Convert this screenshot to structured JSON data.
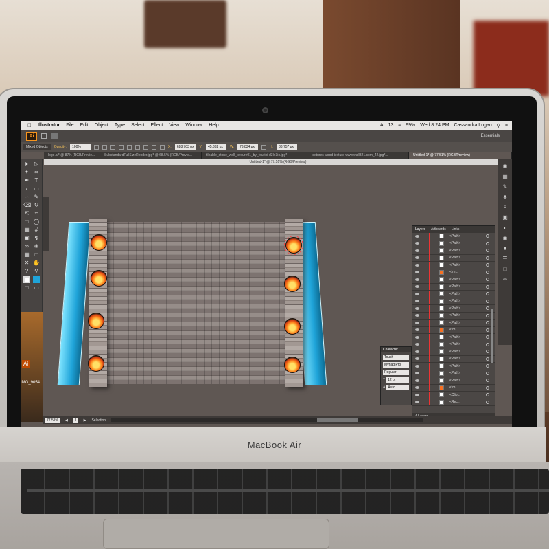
{
  "device_brand": "MacBook Air",
  "menubar": {
    "app_name": "Illustrator",
    "menus": [
      "File",
      "Edit",
      "Object",
      "Type",
      "Select",
      "Effect",
      "View",
      "Window",
      "Help"
    ],
    "adobe_badge": "13",
    "battery": "99%",
    "clock": "Wed 8:24 PM",
    "user": "Cassandra Logan"
  },
  "appbar": {
    "logo": "Ai",
    "workspace": "Essentials"
  },
  "control_bar": {
    "selection_type": "Mixed Objects",
    "opacity_label": "Opacity:",
    "opacity_value": "100%",
    "x_label": "X:",
    "x_value": "628.703 px",
    "y_label": "Y:",
    "y_value": "45.832 px",
    "w_label": "W:",
    "w_value": "73.834 px",
    "h_label": "H:",
    "h_value": "88.757 px"
  },
  "tabs": [
    "logo.ai* @ 87% (RGB/Previe...",
    "SubstandardFullSizeRender.jpg* @ 68.5% (RGB/Previe...",
    "tileable_stone_wall_texture01_by_fourini-d3le3io.jpg*",
    "textures wood texture www.wall321.com_42.jpg*...",
    "Untitled-1* @ 77.51% (RGB/Preview)"
  ],
  "document_title": "Untitled-1* @ 77.51% (RGB/Preview)",
  "status_bar": {
    "zoom": "77.51%",
    "artboard": "1",
    "tool_name": "Selection"
  },
  "layers_panel": {
    "tabs": [
      "Layers",
      "Artboards",
      "Links"
    ],
    "rows": [
      {
        "name": "<Path>",
        "type": "path"
      },
      {
        "name": "<Path>",
        "type": "path"
      },
      {
        "name": "<Path>",
        "type": "path"
      },
      {
        "name": "<Path>",
        "type": "path"
      },
      {
        "name": "<Path>",
        "type": "path"
      },
      {
        "name": "<Im...",
        "type": "image"
      },
      {
        "name": "<Path>",
        "type": "path"
      },
      {
        "name": "<Path>",
        "type": "path"
      },
      {
        "name": "<Path>",
        "type": "path"
      },
      {
        "name": "<Path>",
        "type": "path"
      },
      {
        "name": "<Path>",
        "type": "path"
      },
      {
        "name": "<Path>",
        "type": "path"
      },
      {
        "name": "<Path>",
        "type": "path"
      },
      {
        "name": "<Im...",
        "type": "image"
      },
      {
        "name": "<Path>",
        "type": "path"
      },
      {
        "name": "<Path>",
        "type": "path"
      },
      {
        "name": "<Path>",
        "type": "path"
      },
      {
        "name": "<Path>",
        "type": "path"
      },
      {
        "name": "<Path>",
        "type": "path"
      },
      {
        "name": "<Path>",
        "type": "path"
      },
      {
        "name": "<Path>",
        "type": "path"
      },
      {
        "name": "<Im...",
        "type": "image"
      },
      {
        "name": "<Clip...",
        "type": "clip"
      },
      {
        "name": "<Rec...",
        "type": "rect"
      }
    ],
    "footer": "4 Layers"
  },
  "character_panel": {
    "title": "Character",
    "touch_label": "Touch",
    "font_family": "Myriad Pro",
    "font_style": "Regular",
    "font_size": "12 pt",
    "leading": "Auto"
  },
  "dock": {
    "ai_label": "Ai",
    "image_label": "IMG_9054"
  },
  "colors": {
    "ai_orange": "#f7941d",
    "glass_blue": "#1fa4d9",
    "canvas_gray": "#5f5753",
    "layer_marker_red": "#e33333"
  }
}
